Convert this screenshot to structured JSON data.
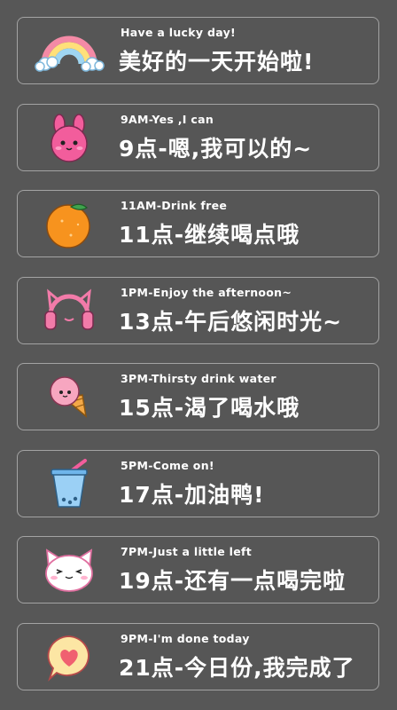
{
  "items": [
    {
      "icon": "rainbow-icon",
      "subtitle": "Have a lucky day!",
      "title": "美好的一天开始啦!"
    },
    {
      "icon": "pink-bunny-icon",
      "subtitle": "9AM-Yes ,I can",
      "title": "9点-嗯,我可以的~"
    },
    {
      "icon": "orange-icon",
      "subtitle": "11AM-Drink free",
      "title": "11点-继续喝点哦"
    },
    {
      "icon": "cat-headphones-icon",
      "subtitle": "1PM-Enjoy the afternoon~",
      "title": "13点-午后悠闲时光~"
    },
    {
      "icon": "ice-cream-icon",
      "subtitle": "3PM-Thirsty drink water",
      "title": "15点-渴了喝水哦"
    },
    {
      "icon": "bubble-tea-icon",
      "subtitle": "5PM-Come on!",
      "title": "17点-加油鸭!"
    },
    {
      "icon": "cat-face-icon",
      "subtitle": "7PM-Just a little left",
      "title": "19点-还有一点喝完啦"
    },
    {
      "icon": "heart-bubble-icon",
      "subtitle": "9PM-I'm done today",
      "title": "21点-今日份,我完成了"
    }
  ],
  "colors": {
    "background": "#575757",
    "card_border": "#a3a3a3",
    "text": "#ffffff"
  }
}
